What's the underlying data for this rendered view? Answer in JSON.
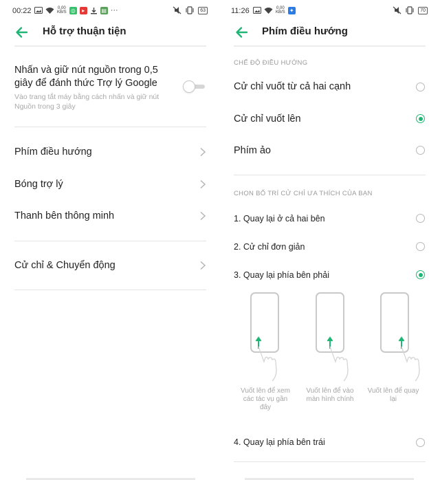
{
  "left": {
    "status": {
      "time": "00:22",
      "speed_top": "0,00",
      "speed_bottom": "KB/S",
      "battery": "63"
    },
    "title": "Hỗ trợ thuận tiện",
    "power_setting": {
      "title_line1": "Nhấn và giữ nút nguồn trong 0,5",
      "title_line2": "giây để đánh thức Trợ lý Google",
      "sub_line1": "Vào trang tắt máy bằng cách nhấn và giữ nút",
      "sub_line2": "Nguồn trong 3 giây",
      "enabled": false
    },
    "items": [
      {
        "label": "Phím điều hướng"
      },
      {
        "label": "Bóng trợ lý"
      },
      {
        "label": "Thanh bên thông minh"
      },
      {
        "label": "Cử chỉ & Chuyển động"
      }
    ]
  },
  "right": {
    "status": {
      "time": "11:26",
      "speed_top": "0,00",
      "speed_bottom": "KB/S",
      "battery": "70"
    },
    "title": "Phím điều hướng",
    "section_mode": "CHẾ ĐỘ ĐIỀU HƯỚNG",
    "modes": [
      {
        "label": "Cử chỉ vuốt từ cả hai cạnh",
        "selected": false
      },
      {
        "label": "Cử chỉ vuốt lên",
        "selected": true
      },
      {
        "label": "Phím ảo",
        "selected": false
      }
    ],
    "section_layout": "CHỌN BỐ TRÍ CỬ CHỈ ƯA THÍCH CỦA BẠN",
    "layouts": [
      {
        "label": "1. Quay lại ở cả hai bên",
        "selected": false
      },
      {
        "label": "2. Cử chỉ đơn giản",
        "selected": false
      },
      {
        "label": "3. Quay lại phía bên phải",
        "selected": true
      },
      {
        "label": "4. Quay lại phía bên trái",
        "selected": false
      }
    ],
    "illustrations": [
      {
        "line1": "Vuốt lên để xem",
        "line2": "các tác vụ gần",
        "line3": "đây"
      },
      {
        "line1": "Vuốt lên để vào",
        "line2": "màn hình chính",
        "line3": ""
      },
      {
        "line1": "Vuốt lên để quay",
        "line2": "lại",
        "line3": ""
      }
    ]
  },
  "colors": {
    "accent": "#1fb574",
    "divider": "#e4e4e4",
    "secondary_text": "#aaaaaa"
  }
}
